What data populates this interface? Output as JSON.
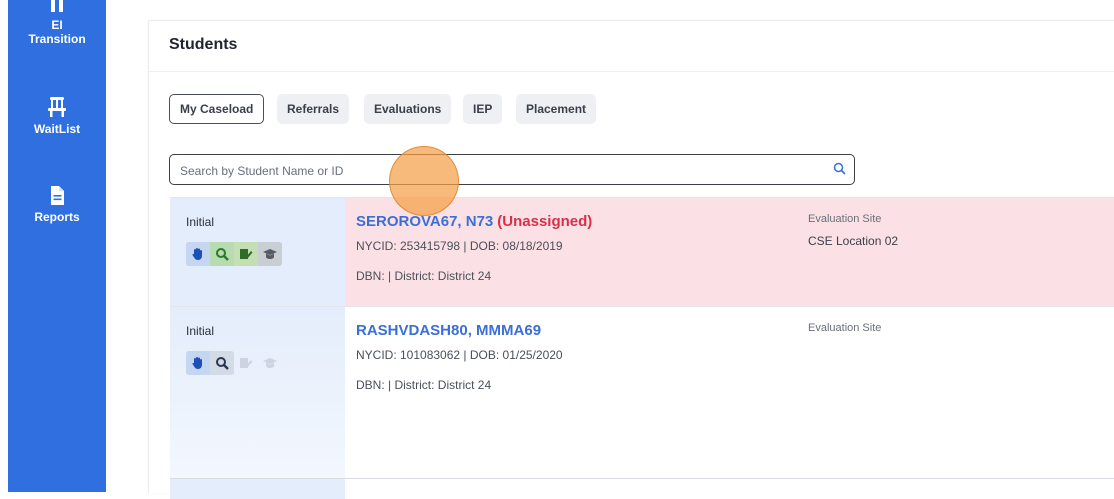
{
  "sidebar": {
    "items": [
      {
        "label_line1": "EI",
        "label_line2": "Transition",
        "icon": "people-icon"
      },
      {
        "label": "WaitList",
        "icon": "chair-icon"
      },
      {
        "label": "Reports",
        "icon": "document-icon"
      }
    ]
  },
  "page": {
    "title": "Students",
    "tabs": [
      {
        "label": "My Caseload",
        "active": true
      },
      {
        "label": "Referrals",
        "active": false
      },
      {
        "label": "Evaluations",
        "active": false
      },
      {
        "label": "IEP",
        "active": false
      },
      {
        "label": "Placement",
        "active": false
      }
    ],
    "search": {
      "placeholder": "Search by Student Name or ID",
      "value": ""
    }
  },
  "students": [
    {
      "type": "Initial",
      "name": "SEROROVA67, N73",
      "status": "(Unassigned)",
      "ids": "NYCID: 253415798 | DOB: 08/18/2019",
      "district": "DBN: | District: District 24",
      "eval_label": "Evaluation Site",
      "eval_value": "CSE Location 02"
    },
    {
      "type": "Initial",
      "name": "RASHVDASH80, MMMA69",
      "status": "",
      "ids": "NYCID: 101083062 | DOB: 01/25/2020",
      "district": "DBN: | District: District 24",
      "eval_label": "Evaluation Site",
      "eval_value": ""
    }
  ],
  "colors": {
    "sidebar": "#2f6fe0",
    "link": "#3a6fd8",
    "unassigned": "#d9304a",
    "row_highlight": "#fbe1e5"
  }
}
